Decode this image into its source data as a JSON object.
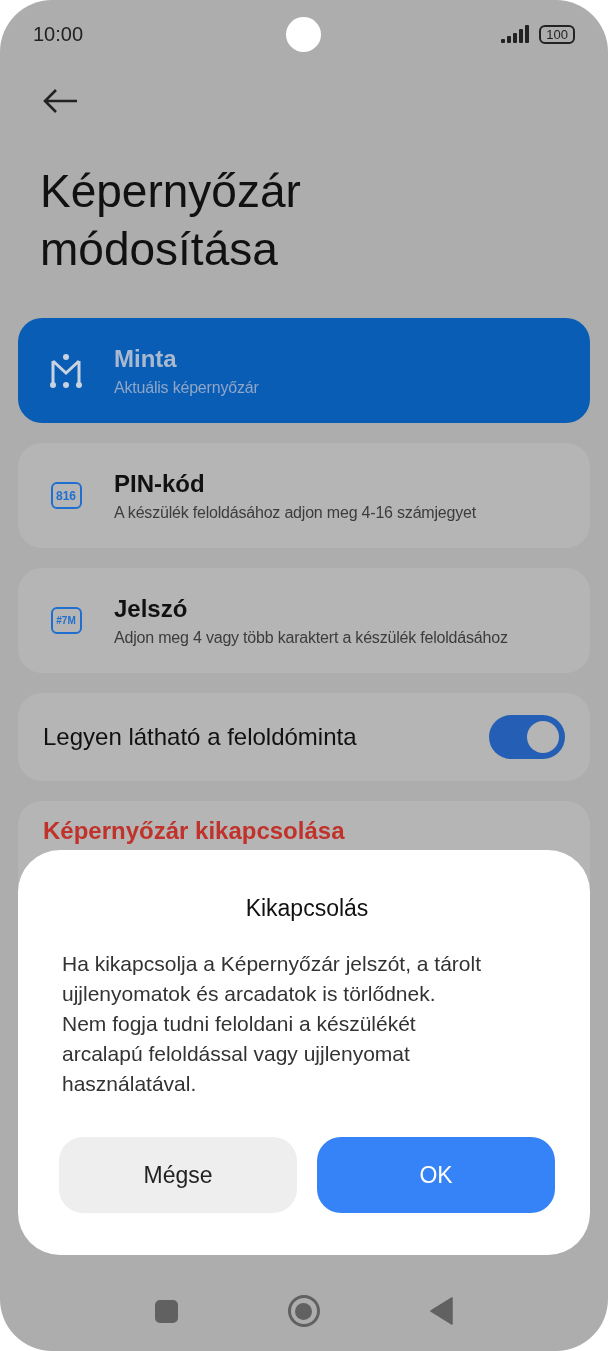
{
  "status_bar": {
    "time": "10:00",
    "battery": "100"
  },
  "page": {
    "title": "Képernyőzár módosítása"
  },
  "options": [
    {
      "kind": "pattern",
      "title": "Minta",
      "subtitle": "Aktuális képernyőzár",
      "selected": true
    },
    {
      "kind": "pin",
      "icon_text": "816",
      "title": "PIN-kód",
      "subtitle": "A készülék feloldásához adjon meg 4-16 számjegyet",
      "selected": false
    },
    {
      "kind": "password",
      "icon_text": "#7M",
      "title": "Jelszó",
      "subtitle": "Adjon meg 4 vagy több karaktert a készülék feloldásához",
      "selected": false
    }
  ],
  "visible_pattern": {
    "label": "Legyen látható a feloldóminta",
    "on": true
  },
  "disable_lock": {
    "label": "Képernyőzár kikapcsolása"
  },
  "dialog": {
    "title": "Kikapcsolás",
    "message": "Ha kikapcsolja a Képernyőzár jelszót, a tárolt ujjlenyomatok és arcadatok is törlődnek. Nem fogja tudni feloldani a készülékét arcalapú feloldással vagy ujjlenyomat használatával.",
    "buttons": [
      {
        "label": "Mégse",
        "kind": "secondary"
      },
      {
        "label": "OK",
        "kind": "primary"
      }
    ]
  }
}
